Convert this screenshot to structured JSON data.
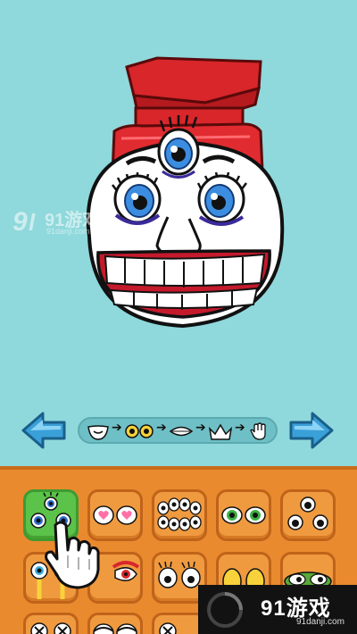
{
  "watermark_left": {
    "logo": "91游戏",
    "site": "91danji.com"
  },
  "watermark_right": {
    "logo": "91游戏",
    "site": "91danji.com"
  },
  "step_bar": {
    "steps": [
      "face-shape",
      "eyes",
      "mouth",
      "hat",
      "hand"
    ],
    "active_step": "eyes"
  },
  "palette": {
    "selected_tile": 0,
    "tiles": [
      "multi-green-eyes",
      "pink-heart-eyes",
      "cluster-eyes",
      "green-eyes",
      "three-dot-eyes",
      "stalk-eyes",
      "red-eye-lid",
      "lashed-eyes",
      "yellow-eyes",
      "frog-eyes",
      "x-eyes",
      "droopy-eyes",
      "closed-eyes"
    ]
  },
  "colors": {
    "background": "#8fd8dc",
    "hat": "#d8262b",
    "panel": "#e98a2e",
    "tile_selected": "#5bc24a",
    "arrow": "#3aa0d8"
  }
}
